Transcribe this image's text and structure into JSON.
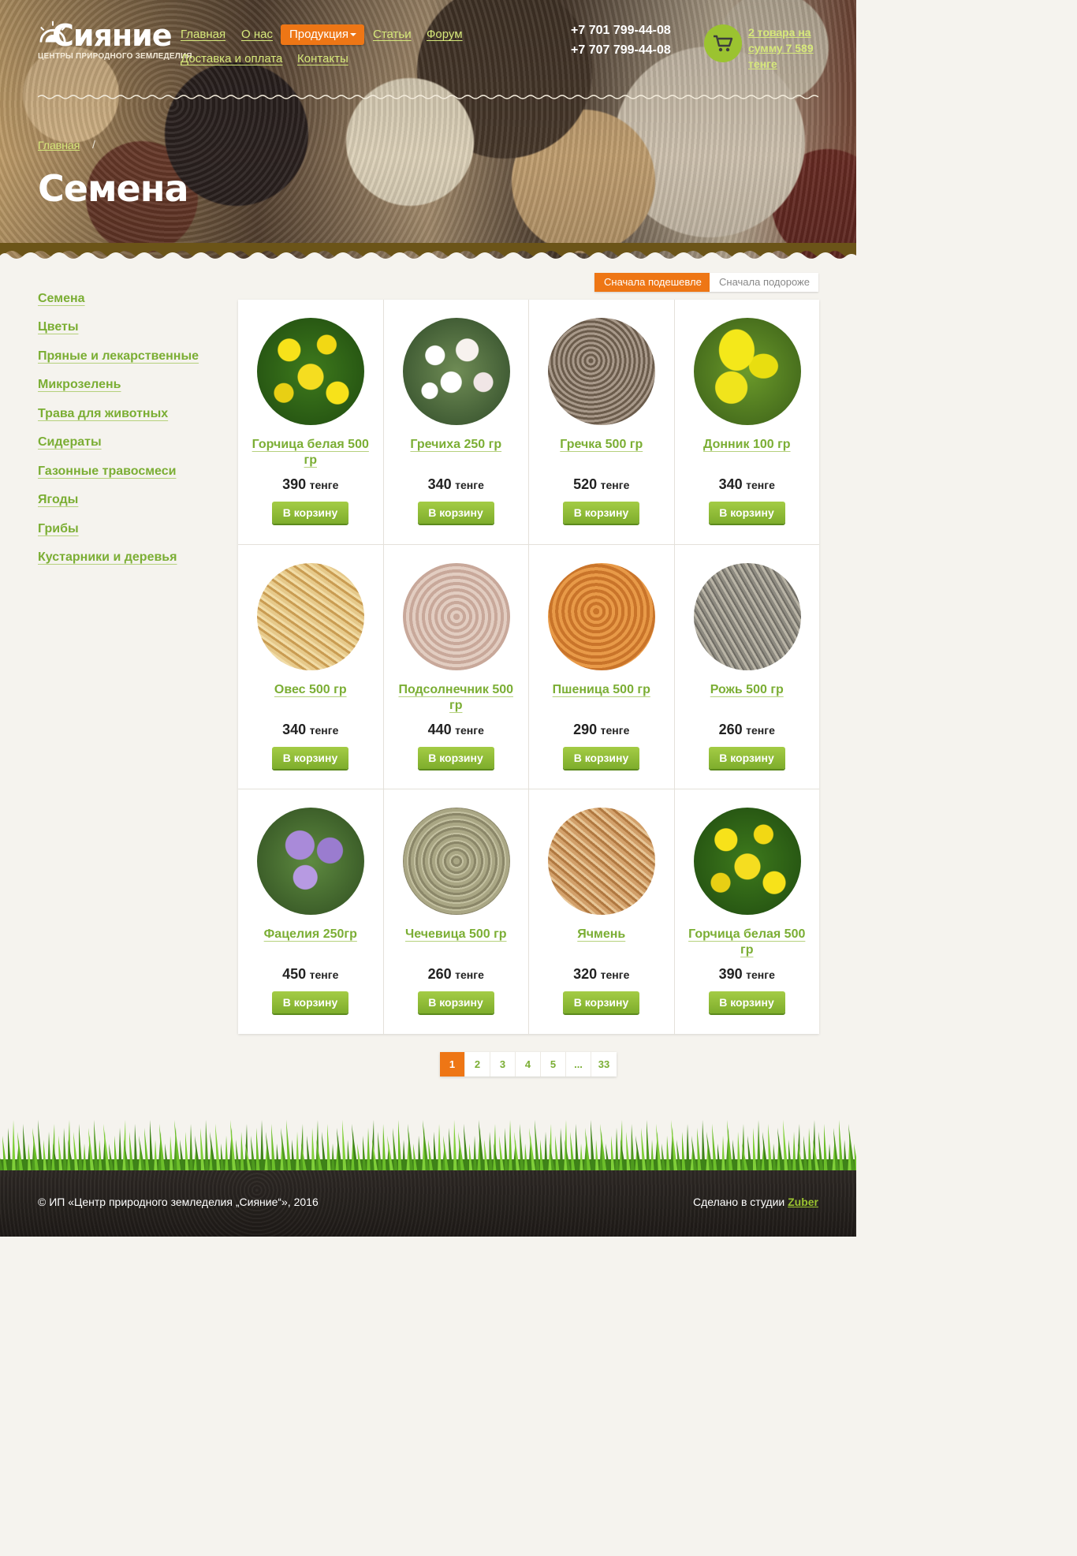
{
  "header": {
    "logo_title": "Сияние",
    "logo_subtitle": "ЦЕНТРЫ ПРИРОДНОГО ЗЕМЛЕДЕЛИЯ",
    "nav": {
      "home": "Главная",
      "about": "О нас",
      "products": "Продукция",
      "articles": "Статьи",
      "forum": "Форум",
      "delivery": "Доставка и оплата",
      "contacts": "Контакты"
    },
    "phones": [
      "+7 701 799-44-08",
      "+7 707 799-44-08"
    ],
    "cart_summary": "2 товара на сумму 7 589 тенге"
  },
  "breadcrumb": {
    "home": "Главная",
    "separator": "/"
  },
  "page_title": "Семена",
  "sidebar": {
    "items": [
      "Семена",
      "Цветы",
      "Пряные и лекарственные",
      "Микрозелень",
      "Трава для животных",
      "Сидераты",
      "Газонные травосмеси",
      "Ягоды",
      "Грибы",
      "Кустарники и деревья"
    ]
  },
  "sort": {
    "cheap_first": "Сначала подешевле",
    "expensive_first": "Сначала подороже"
  },
  "currency": "тенге",
  "add_to_cart": "В корзину",
  "products": [
    {
      "name": "Горчица белая 500 гр",
      "price": "390",
      "image": "mustard-flowers"
    },
    {
      "name": "Гречиха 250 гр",
      "price": "340",
      "image": "buckwheat-flowers"
    },
    {
      "name": "Гречка 500 гр",
      "price": "520",
      "image": "buckwheat-grain"
    },
    {
      "name": "Донник 100 гр",
      "price": "340",
      "image": "sweet-clover-flowers"
    },
    {
      "name": "Овес 500 гр",
      "price": "340",
      "image": "oat-grain"
    },
    {
      "name": "Подсолнечник 500 гр",
      "price": "440",
      "image": "sunflower-seeds"
    },
    {
      "name": "Пшеница 500 гр",
      "price": "290",
      "image": "wheat-grain"
    },
    {
      "name": "Рожь 500 гр",
      "price": "260",
      "image": "rye-grain"
    },
    {
      "name": "Фацелия 250гр",
      "price": "450",
      "image": "phacelia-flowers"
    },
    {
      "name": "Чечевица 500 гр",
      "price": "260",
      "image": "lentils"
    },
    {
      "name": "Ячмень",
      "price": "320",
      "image": "barley-grain"
    },
    {
      "name": "Горчица белая 500 гр",
      "price": "390",
      "image": "mustard-flowers"
    }
  ],
  "pagination": {
    "pages": [
      "1",
      "2",
      "3",
      "4",
      "5",
      "...",
      "33"
    ],
    "current": "1"
  },
  "footer": {
    "copyright": "© ИП «Центр природного земледелия „Сияние“», 2016",
    "made_by": "Сделано в студии",
    "studio": "Zuber"
  },
  "colors": {
    "accent_orange": "#ee7615",
    "accent_green": "#7bae34",
    "button_green": "#8cbc33"
  }
}
